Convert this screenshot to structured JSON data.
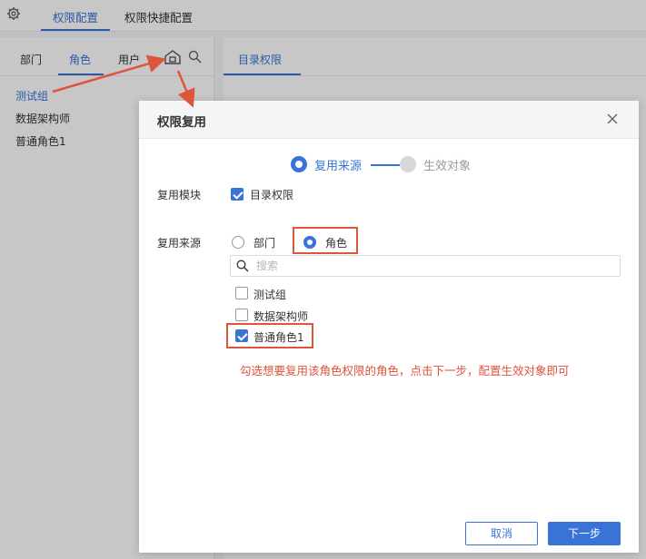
{
  "topbar": {
    "tabs": [
      {
        "label": "权限配置",
        "active": true
      },
      {
        "label": "权限快捷配置",
        "active": false
      }
    ]
  },
  "left_panel": {
    "tabs": [
      {
        "label": "部门",
        "active": false
      },
      {
        "label": "角色",
        "active": true
      },
      {
        "label": "用户",
        "active": false
      }
    ],
    "items": [
      {
        "label": "测试组",
        "active": true
      },
      {
        "label": "数据架构师",
        "active": false
      },
      {
        "label": "普通角色1",
        "active": false
      }
    ]
  },
  "right_panel": {
    "tab": "目录权限"
  },
  "modal": {
    "title": "权限复用",
    "steps": [
      {
        "label": "复用来源",
        "active": true
      },
      {
        "label": "生效对象",
        "active": false
      }
    ],
    "module_label": "复用模块",
    "module_option": "目录权限",
    "source_label": "复用来源",
    "source_options": [
      {
        "label": "部门",
        "selected": false
      },
      {
        "label": "角色",
        "selected": true
      }
    ],
    "search_placeholder": "搜索",
    "role_list": [
      {
        "label": "测试组",
        "checked": false
      },
      {
        "label": "数据架构师",
        "checked": false
      },
      {
        "label": "普通角色1",
        "checked": true
      }
    ],
    "annotation": "勾选想要复用该角色权限的角色，点击下一步，配置生效对象即可",
    "cancel_label": "取消",
    "next_label": "下一步"
  },
  "colors": {
    "accent": "#3a73d8",
    "annotation_red": "#e0533c"
  }
}
